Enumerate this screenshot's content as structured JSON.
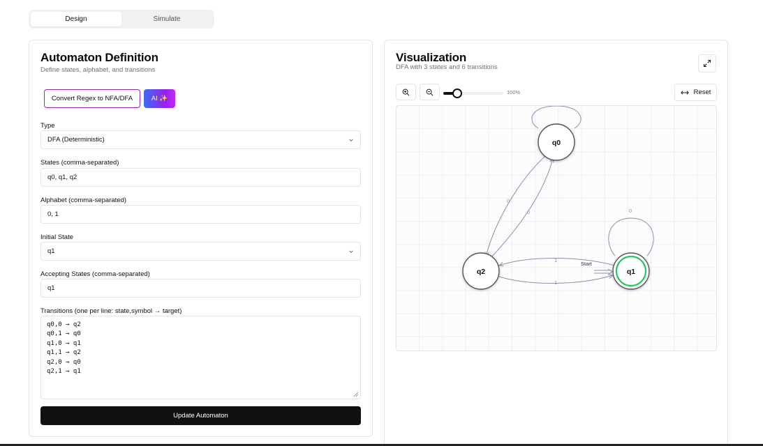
{
  "tabs": [
    {
      "label": "Design",
      "active": true
    },
    {
      "label": "Simulate",
      "active": false
    }
  ],
  "definition": {
    "title": "Automaton Definition",
    "subtitle": "Define states, alphabet, and transitions",
    "regex_button": "Convert Regex to NFA/DFA",
    "ai_button": "AI ✨",
    "type": {
      "label": "Type",
      "value": "DFA (Deterministic)"
    },
    "states": {
      "label": "States (comma-separated)",
      "value": "q0, q1, q2"
    },
    "alphabet": {
      "label": "Alphabet (comma-separated)",
      "value": "0, 1"
    },
    "initial": {
      "label": "Initial State",
      "value": "q1"
    },
    "accepting": {
      "label": "Accepting States (comma-separated)",
      "value": "q1"
    },
    "transitions": {
      "label": "Transitions (one per line: state,symbol → target)",
      "lines": [
        "q0,0 → q2",
        "q0,1 → q0",
        "q1,0 → q1",
        "q1,1 → q2",
        "q2,0 → q0",
        "q2,1 → q1"
      ]
    },
    "update_button": "Update Automaton"
  },
  "visualization": {
    "title": "Visualization",
    "subtitle": "DFA with 3 states and 6 transitions",
    "zoom_level": "100%",
    "zoom_fraction": 0.2,
    "reset_button": "Reset",
    "icons": {
      "expand": "expand-icon",
      "zoom_in": "zoom-in-icon",
      "zoom_out": "zoom-out-icon",
      "reset": "arrows-horizontal-icon"
    },
    "graph": {
      "nodes": [
        {
          "id": "q0",
          "label": "q0",
          "accepting": false,
          "initial": false
        },
        {
          "id": "q1",
          "label": "q1",
          "accepting": true,
          "initial": true
        },
        {
          "id": "q2",
          "label": "q2",
          "accepting": false,
          "initial": false
        }
      ],
      "edges": [
        {
          "from": "q0",
          "to": "q0",
          "label": ""
        },
        {
          "from": "q0",
          "to": "q2",
          "label": "0"
        },
        {
          "from": "q2",
          "to": "q0",
          "label": "0"
        },
        {
          "from": "q1",
          "to": "q1",
          "label": "0"
        },
        {
          "from": "q1",
          "to": "q2",
          "label": "1"
        },
        {
          "from": "q2",
          "to": "q1",
          "label": "1"
        }
      ],
      "start_label": "Start",
      "accent_color": "#22c55e",
      "edge_color": "#8a8fb0"
    }
  }
}
